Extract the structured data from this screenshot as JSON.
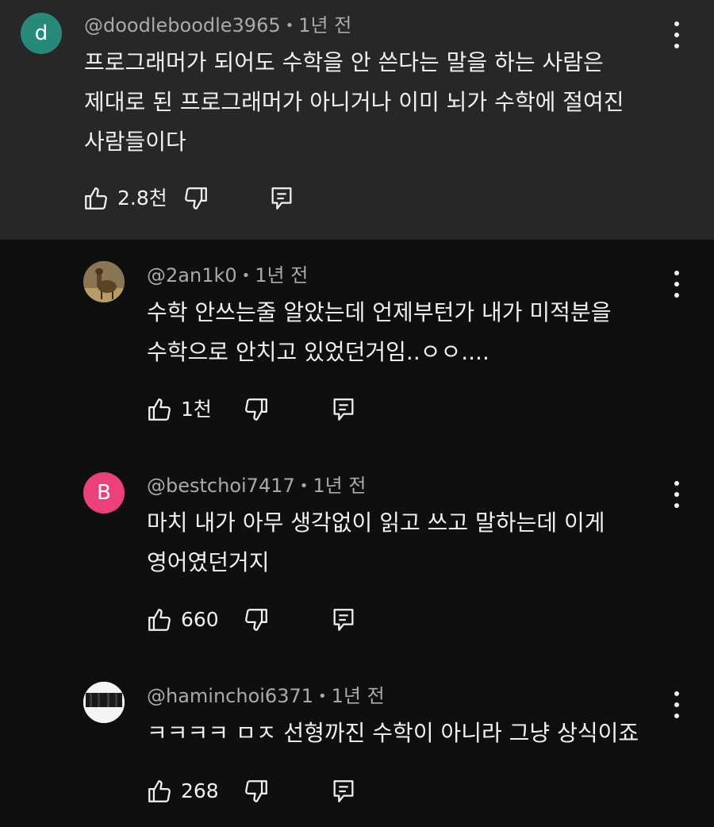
{
  "colors": {
    "top_comment_bg": "#272727",
    "page_bg": "#0f0f0f",
    "text_primary": "#f1f1f1",
    "text_secondary": "#aaaaaa",
    "avatar_d_bg": "#26897a",
    "avatar_b_bg": "#ec407a"
  },
  "icons": {
    "like": "thumbs-up-outline",
    "dislike": "thumbs-down-outline",
    "reply": "reply-comment-outline",
    "more": "three-dot-vertical"
  },
  "comments": [
    {
      "avatar_letter": "d",
      "username": "@doodleboodle3965",
      "separator": "•",
      "time": "1년 전",
      "lines": [
        "프로그래머가 되어도 수학을 안 쓴다는 말을 하는 사람은",
        "제대로 된 프로그래머가 아니거나 이미 뇌가 수학에 절여진",
        "사람들이다"
      ],
      "likes": "2.8천"
    },
    {
      "avatar_letter": "",
      "username": "@2an1k0",
      "separator": "•",
      "time": "1년 전",
      "lines": [
        "수학 안쓰는줄 알았는데 언제부턴가 내가 미적분을",
        "수학으로 안치고 있었던거임..ㅇㅇ...."
      ],
      "likes": "1천"
    },
    {
      "avatar_letter": "B",
      "username": "@bestchoi7417",
      "separator": "•",
      "time": "1년 전",
      "lines": [
        "마치 내가 아무 생각없이 읽고 쓰고 말하는데 이게",
        "영어였던거지"
      ],
      "likes": "660"
    },
    {
      "avatar_letter": "",
      "username": "@haminchoi6371",
      "separator": "•",
      "time": "1년 전",
      "lines": [
        "ㅋㅋㅋㅋ ㅁㅈ 선형까진 수학이 아니라 그냥 상식이죠"
      ],
      "likes": "268"
    }
  ]
}
